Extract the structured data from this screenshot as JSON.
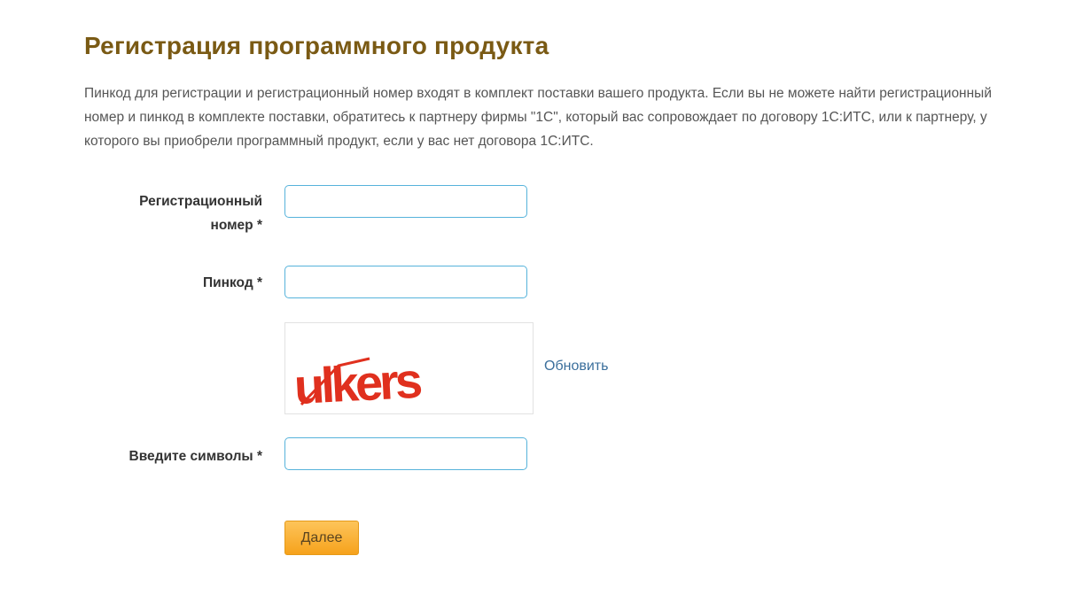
{
  "page": {
    "title": "Регистрация программного продукта",
    "intro": "Пинкод для регистрации и регистрационный номер входят в комплект поставки вашего продукта. Если вы не можете найти регистрационный номер и пинкод в комплекте поставки, обратитесь к партнеру фирмы \"1С\", который вас сопровождает по договору 1С:ИТС, или к партнеру, у которого вы приобрели программный продукт, если у вас нет договора 1С:ИТС."
  },
  "form": {
    "reg_number": {
      "label_line1": "Регистрационный",
      "label_line2": "номер *",
      "value": "",
      "placeholder": ""
    },
    "pincode": {
      "label": "Пинкод *",
      "value": "",
      "placeholder": ""
    },
    "captcha": {
      "image_text": "ulkers",
      "text_color": "#e0301e",
      "refresh_label": "Обновить"
    },
    "symbols": {
      "label": "Введите символы *",
      "value": "",
      "placeholder": ""
    },
    "submit_label": "Далее"
  },
  "colors": {
    "title": "#7a5a14",
    "input_border": "#56b3db",
    "button": "#f6a21c",
    "link": "#3b6f9c"
  }
}
